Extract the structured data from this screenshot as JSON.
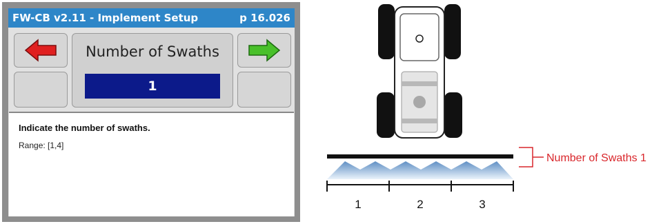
{
  "device": {
    "title": "FW-CB v2.11 - Implement Setup",
    "page": "p 16.026",
    "parameter": {
      "name": "Number of Swaths",
      "value": "1"
    },
    "buttons": {
      "prev": "left-arrow-icon",
      "next": "right-arrow-icon"
    },
    "help": {
      "text": "Indicate the number of swaths.",
      "range": "Range: [1,4]"
    },
    "colors": {
      "title_bg": "#2e86c8",
      "value_bg": "#0c1a8a",
      "prev_arrow": "#e02020",
      "next_arrow": "#49c02a"
    }
  },
  "diagram": {
    "swath_label": "Number of Swaths 1",
    "section_labels": [
      "1",
      "2",
      "3"
    ],
    "colors": {
      "annotation": "#d9262b",
      "spray": "#9fc4e6"
    }
  }
}
